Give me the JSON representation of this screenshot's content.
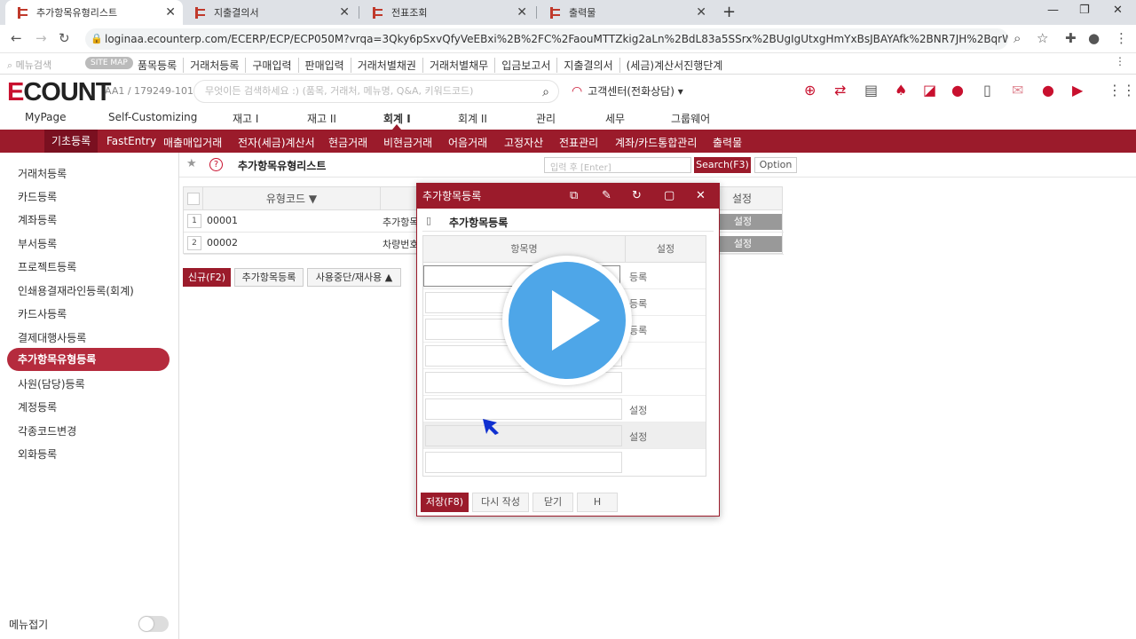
{
  "browser": {
    "tabs": [
      {
        "label": "추가항목유형리스트",
        "active": true
      },
      {
        "label": "지출결의서",
        "active": false
      },
      {
        "label": "전표조회",
        "active": false
      },
      {
        "label": "출력물",
        "active": false
      }
    ],
    "url": "loginaa.ecounterp.com/ECERP/ECP/ECP050M?vrqa=3Qky6pSxvQfyVeEBxi%2B%2FC%2FaouMTTZkig2aLn%2BdL83a5SSrx%2BUgIgUtxgHmYxBsJBAYAfk%2BNR7JH%2BqrWHmE177w%3D%3D..."
  },
  "bookmarks": {
    "search_placeholder": "메뉴검색",
    "sitemap": "SITE MAP",
    "items": [
      "품목등록",
      "거래처등록",
      "구매입력",
      "판매입력",
      "거래처별채권",
      "거래처별채무",
      "입금보고서",
      "지출결의서",
      "(세금)계산서진행단계"
    ]
  },
  "header": {
    "logo_e": "E",
    "logo_rest": "COUNT",
    "account": "AA1 / 179249-101",
    "search_placeholder": "무엇이든 검색하세요 :) (품목, 거래처, 메뉴명, Q&A, 키워드코드)",
    "customer_center": "고객센터(전화상담)"
  },
  "main_menu": [
    {
      "label": "MyPage",
      "active": false
    },
    {
      "label": "Self-Customizing",
      "active": false
    },
    {
      "label": "재고 I",
      "active": false
    },
    {
      "label": "재고 II",
      "active": false
    },
    {
      "label": "회계 I",
      "active": true
    },
    {
      "label": "회계 II",
      "active": false
    },
    {
      "label": "관리",
      "active": false
    },
    {
      "label": "세무",
      "active": false
    },
    {
      "label": "그룹웨어",
      "active": false
    }
  ],
  "sub_menu": [
    {
      "label": "기초등록",
      "active": true
    },
    {
      "label": "FastEntry"
    },
    {
      "label": "매출매입거래"
    },
    {
      "label": "전자(세금)계산서"
    },
    {
      "label": "현금거래"
    },
    {
      "label": "비현금거래"
    },
    {
      "label": "어음거래"
    },
    {
      "label": "고정자산"
    },
    {
      "label": "전표관리"
    },
    {
      "label": "계좌/카드통합관리"
    },
    {
      "label": "출력물"
    }
  ],
  "sidebar": {
    "items": [
      {
        "label": "거래처등록"
      },
      {
        "label": "카드등록"
      },
      {
        "label": "계좌등록"
      },
      {
        "label": "부서등록"
      },
      {
        "label": "프로젝트등록"
      },
      {
        "label": "인쇄용결재라인등록(회계)"
      },
      {
        "label": "카드사등록"
      },
      {
        "label": "결제대행사등록"
      },
      {
        "label": "추가항목유형등록",
        "active": true
      },
      {
        "label": "사원(담당)등록"
      },
      {
        "label": "계정등록"
      },
      {
        "label": "각종코드변경"
      },
      {
        "label": "외화등록"
      }
    ],
    "fold_label": "메뉴접기"
  },
  "page": {
    "title": "추가항목유형리스트",
    "search_placeholder": "입력 후 [Enter]",
    "search_button": "Search(F3)",
    "option_button": "Option"
  },
  "grid": {
    "col_code": "유형코드 ▼",
    "col_setting": "설정",
    "rows": [
      {
        "num": "1",
        "code": "00001",
        "name": "추가항목",
        "setting": "설정"
      },
      {
        "num": "2",
        "code": "00002",
        "name": "차량번호",
        "setting": "설정"
      }
    ]
  },
  "actions": {
    "new": "신규(F2)",
    "add_item": "추가항목등록",
    "toggle_use": "사용중단/재사용"
  },
  "modal": {
    "title": "추가항목등록",
    "subtitle": "추가항목등록",
    "col_item": "항목명",
    "col_setting": "설정",
    "rows": [
      {
        "setting": "등록",
        "state": "focus"
      },
      {
        "setting": "등록",
        "state": "normal"
      },
      {
        "setting": "등록",
        "state": "normal"
      },
      {
        "setting": "",
        "state": "normal"
      },
      {
        "setting": "",
        "state": "normal"
      },
      {
        "setting": "설정",
        "state": "normal"
      },
      {
        "setting": "설정",
        "state": "disabled"
      },
      {
        "setting": "",
        "state": "normal"
      }
    ],
    "buttons": {
      "save": "저장(F8)",
      "rewrite": "다시 작성",
      "close": "닫기",
      "h": "H"
    }
  },
  "colors": {
    "accent": "#9b1b2b",
    "play": "#4ea6e8"
  }
}
